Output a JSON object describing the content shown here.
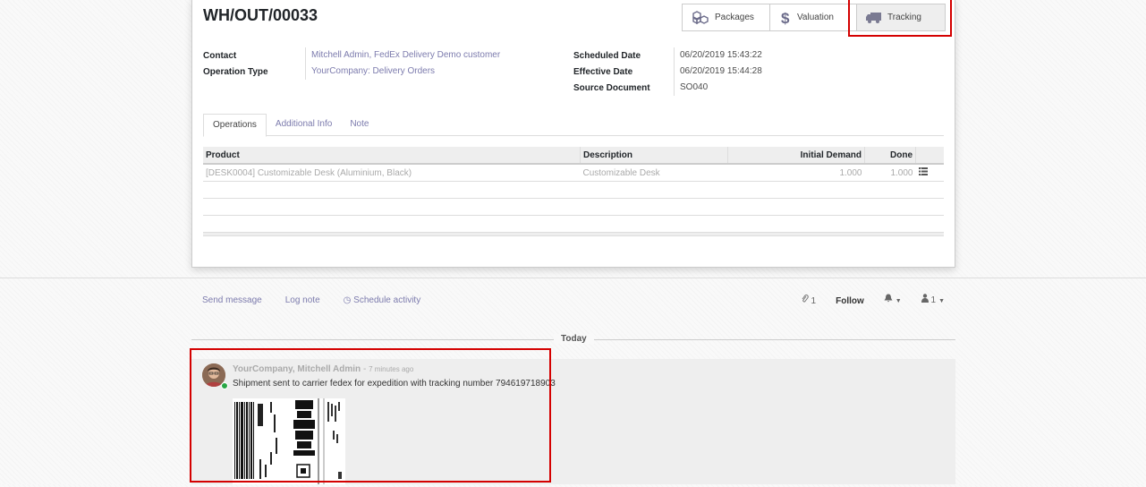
{
  "record": {
    "title": "WH/OUT/00033",
    "smart_buttons": {
      "packages": "Packages",
      "valuation": "Valuation",
      "tracking": "Tracking"
    },
    "fields_left": [
      {
        "label": "Contact",
        "value": "Mitchell Admin, FedEx Delivery Demo customer"
      },
      {
        "label": "Operation Type",
        "value": "YourCompany: Delivery Orders"
      }
    ],
    "fields_right": [
      {
        "label": "Scheduled Date",
        "value": "06/20/2019 15:43:22"
      },
      {
        "label": "Effective Date",
        "value": "06/20/2019 15:44:28"
      },
      {
        "label": "Source Document",
        "value": "SO040"
      }
    ],
    "tabs": [
      "Operations",
      "Additional Info",
      "Note"
    ],
    "table": {
      "headers": [
        "Product",
        "Description",
        "Initial Demand",
        "Done"
      ],
      "rows": [
        {
          "product": "[DESK0004] Customizable Desk (Aluminium, Black)",
          "description": "Customizable Desk",
          "initial_demand": "1.000",
          "done": "1.000"
        }
      ]
    }
  },
  "chatter": {
    "send_message": "Send message",
    "log_note": "Log note",
    "schedule_activity": "Schedule activity",
    "attachments_count": "1",
    "follow": "Follow",
    "followers_count": "1",
    "date_separator": "Today",
    "message": {
      "author": "YourCompany, Mitchell Admin",
      "separator": "-",
      "time_ago": "7 minutes ago",
      "body": "Shipment sent to carrier fedex for expedition with tracking number 794619718903"
    }
  },
  "colors": {
    "link": "#7c7bad",
    "highlight": "#d40000"
  }
}
